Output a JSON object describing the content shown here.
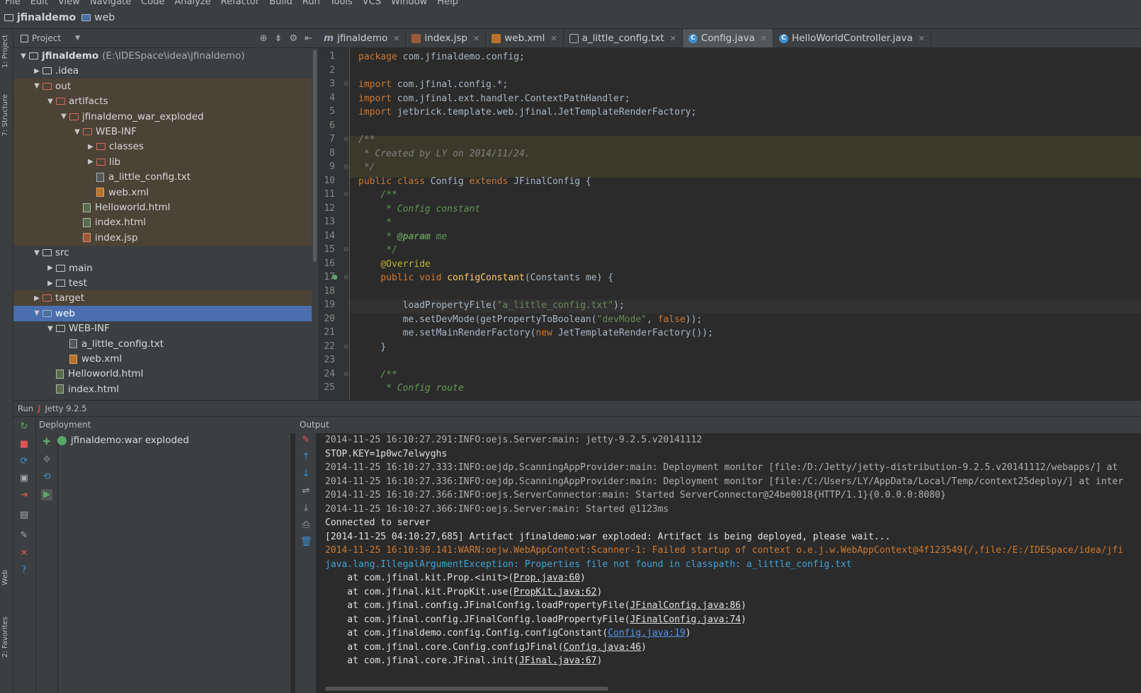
{
  "menu": [
    "File",
    "Edit",
    "View",
    "Navigate",
    "Code",
    "Analyze",
    "Refactor",
    "Build",
    "Run",
    "Tools",
    "VCS",
    "Window",
    "Help"
  ],
  "nav": {
    "project": "jfinaldemo",
    "folder": "web"
  },
  "side_tabs": {
    "project": "1: Project",
    "structure": "7: Structure",
    "web": "Web",
    "favorites": "2: Favorites"
  },
  "project_panel": {
    "title": "Project"
  },
  "tree": [
    {
      "label": "jfinaldemo",
      "extra": "(E:\\IDESpace\\idea\\jfinaldemo)",
      "arrow": "▼",
      "icon": "folder",
      "indent": 0,
      "state": ""
    },
    {
      "label": ".idea",
      "arrow": "▶",
      "icon": "folder",
      "indent": 1,
      "state": ""
    },
    {
      "label": "out",
      "arrow": "▼",
      "icon": "folder-red",
      "indent": 1,
      "state": "ex"
    },
    {
      "label": "artifacts",
      "arrow": "▼",
      "icon": "folder-red",
      "indent": 2,
      "state": "ex"
    },
    {
      "label": "jfinaldemo_war_exploded",
      "arrow": "▼",
      "icon": "folder-red",
      "indent": 3,
      "state": "ex"
    },
    {
      "label": "WEB-INF",
      "arrow": "▼",
      "icon": "folder-red",
      "indent": 4,
      "state": "ex"
    },
    {
      "label": "classes",
      "arrow": "▶",
      "icon": "folder-red",
      "indent": 5,
      "state": "ex"
    },
    {
      "label": "lib",
      "arrow": "▶",
      "icon": "folder-red",
      "indent": 5,
      "state": "ex"
    },
    {
      "label": "a_little_config.txt",
      "arrow": "",
      "icon": "txt",
      "indent": 5,
      "state": "ex"
    },
    {
      "label": "web.xml",
      "arrow": "",
      "icon": "xml",
      "indent": 5,
      "state": "ex"
    },
    {
      "label": "Helloworld.html",
      "arrow": "",
      "icon": "html",
      "indent": 4,
      "state": "ex"
    },
    {
      "label": "index.html",
      "arrow": "",
      "icon": "html",
      "indent": 4,
      "state": "ex"
    },
    {
      "label": "index.jsp",
      "arrow": "",
      "icon": "jsp",
      "indent": 4,
      "state": "ex"
    },
    {
      "label": "src",
      "arrow": "▼",
      "icon": "folder",
      "indent": 1,
      "state": ""
    },
    {
      "label": "main",
      "arrow": "▶",
      "icon": "folder",
      "indent": 2,
      "state": ""
    },
    {
      "label": "test",
      "arrow": "▶",
      "icon": "folder",
      "indent": 2,
      "state": ""
    },
    {
      "label": "target",
      "arrow": "▶",
      "icon": "folder-red",
      "indent": 1,
      "state": "ex"
    },
    {
      "label": "web",
      "arrow": "▼",
      "icon": "folder-web",
      "indent": 1,
      "state": "sel"
    },
    {
      "label": "WEB-INF",
      "arrow": "▼",
      "icon": "folder",
      "indent": 2,
      "state": ""
    },
    {
      "label": "a_little_config.txt",
      "arrow": "",
      "icon": "txt",
      "indent": 3,
      "state": ""
    },
    {
      "label": "web.xml",
      "arrow": "",
      "icon": "xml",
      "indent": 3,
      "state": ""
    },
    {
      "label": "Helloworld.html",
      "arrow": "",
      "icon": "html",
      "indent": 2,
      "state": ""
    },
    {
      "label": "index.html",
      "arrow": "",
      "icon": "html",
      "indent": 2,
      "state": ""
    }
  ],
  "tabs": [
    {
      "label": "jfinaldemo",
      "icon": "m"
    },
    {
      "label": "index.jsp",
      "icon": "jsp"
    },
    {
      "label": "web.xml",
      "icon": "xml"
    },
    {
      "label": "a_little_config.txt",
      "icon": "txt"
    },
    {
      "label": "Config.java",
      "icon": "c",
      "active": true
    },
    {
      "label": "HelloWorldController.java",
      "icon": "c"
    }
  ],
  "code": [
    [
      [
        "kw",
        "package "
      ],
      [
        "",
        "com.jfinaldemo.config;"
      ]
    ],
    [],
    [
      [
        "kw",
        "import "
      ],
      [
        "",
        "com.jfinal.config.*;"
      ]
    ],
    [
      [
        "kw",
        "import "
      ],
      [
        "",
        "com.jfinal.ext.handler.ContextPathHandler;"
      ]
    ],
    [
      [
        "kw",
        "import "
      ],
      [
        "",
        "jetbrick.template.web.jfinal.JetTemplateRenderFactory;"
      ]
    ],
    [],
    [
      [
        "cm",
        "/**"
      ]
    ],
    [
      [
        "cm",
        " * Created by LY on 2014/11/24."
      ]
    ],
    [
      [
        "cm",
        " */"
      ]
    ],
    [
      [
        "kw",
        "public class "
      ],
      [
        "",
        "Config "
      ],
      [
        "kw",
        "extends "
      ],
      [
        "",
        "JFinalConfig {"
      ]
    ],
    [
      [
        "cmg",
        "    /**"
      ]
    ],
    [
      [
        "cmg",
        "     * Config constant"
      ]
    ],
    [
      [
        "cmg",
        "     *"
      ]
    ],
    [
      [
        "cmg",
        "     * "
      ],
      [
        "tg",
        "@param "
      ],
      [
        "cmg",
        "me"
      ]
    ],
    [
      [
        "cmg",
        "     */"
      ]
    ],
    [
      [
        "an",
        "    @Override"
      ]
    ],
    [
      [
        "kw",
        "    public void "
      ],
      [
        "fn",
        "configConstant"
      ],
      [
        "",
        "(Constants me) {"
      ]
    ],
    [],
    [
      [
        "",
        "        loadPropertyFile("
      ],
      [
        "st",
        "\"a_little_config.txt\""
      ],
      [
        "",
        ");"
      ]
    ],
    [
      [
        "",
        "        me.setDevMode(getPropertyToBoolean("
      ],
      [
        "st",
        "\"devMode\""
      ],
      [
        "",
        ", "
      ],
      [
        "kw",
        "false"
      ],
      [
        "",
        "));"
      ]
    ],
    [
      [
        "",
        "        me.setMainRenderFactory("
      ],
      [
        "kw",
        "new "
      ],
      [
        "",
        "JetTemplateRenderFactory());"
      ]
    ],
    [
      [
        "",
        "    }"
      ]
    ],
    [],
    [
      [
        "cmg",
        "    /**"
      ]
    ],
    [
      [
        "cmg",
        "     * Config route"
      ]
    ]
  ],
  "run": {
    "label": "Run",
    "config": "Jetty 9.2.5"
  },
  "deployment": {
    "title": "Deployment",
    "item": "jfinaldemo:war exploded"
  },
  "output": {
    "title": "Output",
    "lines": [
      {
        "k": "grey",
        "t": "2014-11-25 16:10:27.291:INFO:oejs.Server:main: jetty-9.2.5.v20141112"
      },
      {
        "k": "white",
        "t": "STOP.KEY=1p0wc7elwyghs"
      },
      {
        "k": "grey",
        "t": "2014-11-25 16:10:27.333:INFO:oejdp.ScanningAppProvider:main: Deployment monitor [file:/D:/Jetty/jetty-distribution-9.2.5.v20141112/webapps/] at"
      },
      {
        "k": "grey",
        "t": "2014-11-25 16:10:27.336:INFO:oejdp.ScanningAppProvider:main: Deployment monitor [file:/C:/Users/LY/AppData/Local/Temp/context25deploy/] at inter"
      },
      {
        "k": "grey",
        "t": "2014-11-25 16:10:27.366:INFO:oejs.ServerConnector:main: Started ServerConnector@24be0018{HTTP/1.1}{0.0.0.0:8080}"
      },
      {
        "k": "grey",
        "t": "2014-11-25 16:10:27.366:INFO:oejs.Server:main: Started @1123ms"
      },
      {
        "k": "white",
        "t": "Connected to server"
      },
      {
        "k": "white",
        "t": "[2014-11-25 04:10:27,685] Artifact jfinaldemo:war exploded: Artifact is being deployed, please wait..."
      },
      {
        "k": "warn",
        "t": "2014-11-25 16:10:30.141:WARN:oejw.WebAppContext:Scanner-1: Failed startup of context o.e.j.w.WebAppContext@4f123549{/,file:/E:/IDESpace/idea/jfi"
      },
      {
        "k": "err",
        "t": "java.lang.IllegalArgumentException: Properties file not found in classpath: a_little_config.txt"
      },
      {
        "k": "white",
        "t": "    at com.jfinal.kit.Prop.<init>(",
        "link": "Prop.java:60",
        "tail": ")"
      },
      {
        "k": "white",
        "t": "    at com.jfinal.kit.PropKit.use(",
        "link": "PropKit.java:62",
        "tail": ")"
      },
      {
        "k": "white",
        "t": "    at com.jfinal.config.JFinalConfig.loadPropertyFile(",
        "link": "JFinalConfig.java:86",
        "tail": ")"
      },
      {
        "k": "white",
        "t": "    at com.jfinal.config.JFinalConfig.loadPropertyFile(",
        "link": "JFinalConfig.java:74",
        "tail": ")"
      },
      {
        "k": "white",
        "t": "    at com.jfinaldemo.config.Config.configConstant(",
        "link": "Config.java:19",
        "tail": ")",
        "blue": true
      },
      {
        "k": "white",
        "t": "    at com.jfinal.core.Config.configJFinal(",
        "link": "Config.java:46",
        "tail": ")"
      },
      {
        "k": "white",
        "t": "    at com.jfinal.core.JFinal.init(",
        "link": "JFinal.java:67",
        "tail": ")"
      }
    ]
  }
}
